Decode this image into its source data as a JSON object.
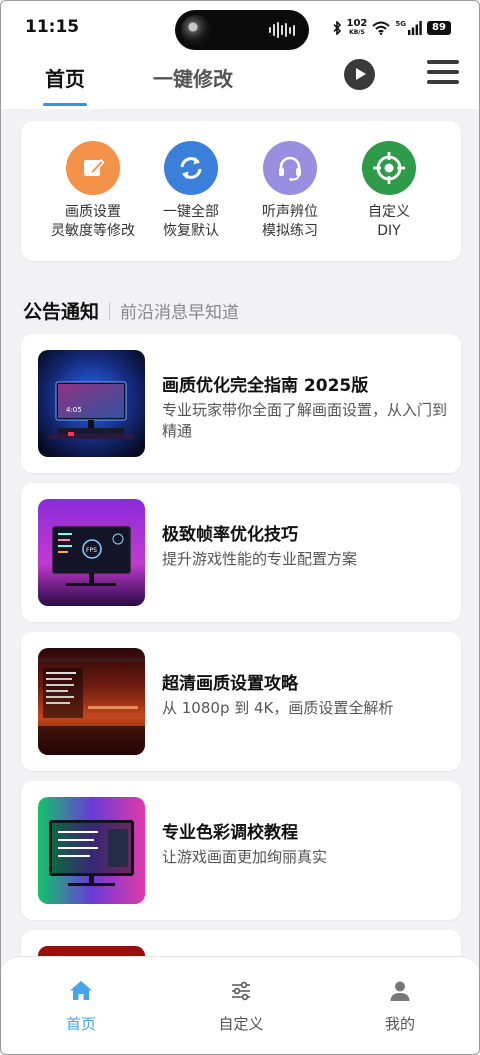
{
  "status_bar": {
    "time": "11:15",
    "net_speed_value": "102",
    "net_speed_unit": "KB/S",
    "signal_label": "5G",
    "battery": "89"
  },
  "header": {
    "tabs": [
      {
        "label": "首页",
        "active": true
      },
      {
        "label": "一键修改",
        "active": false
      }
    ]
  },
  "quick_actions": [
    {
      "icon": "edit-icon",
      "color": "#f5924a",
      "line1": "画质设置",
      "line2": "灵敏度等修改"
    },
    {
      "icon": "sync-icon",
      "color": "#3a7fd8",
      "line1": "一键全部",
      "line2": "恢复默认"
    },
    {
      "icon": "headset-icon",
      "color": "#9a8ee0",
      "line1": "听声辨位",
      "line2": "模拟练习"
    },
    {
      "icon": "crosshair-icon",
      "color": "#2e9b4a",
      "line1": "自定义",
      "line2": "DIY"
    }
  ],
  "announcements": {
    "title": "公告通知",
    "subtitle": "前沿消息早知道",
    "items": [
      {
        "title": "画质优化完全指南 2025版",
        "desc": "专业玩家带你全面了解画面设置，从入门到精通"
      },
      {
        "title": "极致帧率优化技巧",
        "desc": "提升游戏性能的专业配置方案"
      },
      {
        "title": "超清画质设置攻略",
        "desc": "从 1080p 到 4K，画质设置全解析"
      },
      {
        "title": "专业色彩调校教程",
        "desc": "让游戏画面更加绚丽真实"
      }
    ]
  },
  "bottom_nav": [
    {
      "label": "首页",
      "active": true
    },
    {
      "label": "自定义",
      "active": false
    },
    {
      "label": "我的",
      "active": false
    }
  ],
  "colors": {
    "accent": "#3f8fe0",
    "nav_active": "#49a4e6",
    "nav_inactive": "#555555"
  }
}
